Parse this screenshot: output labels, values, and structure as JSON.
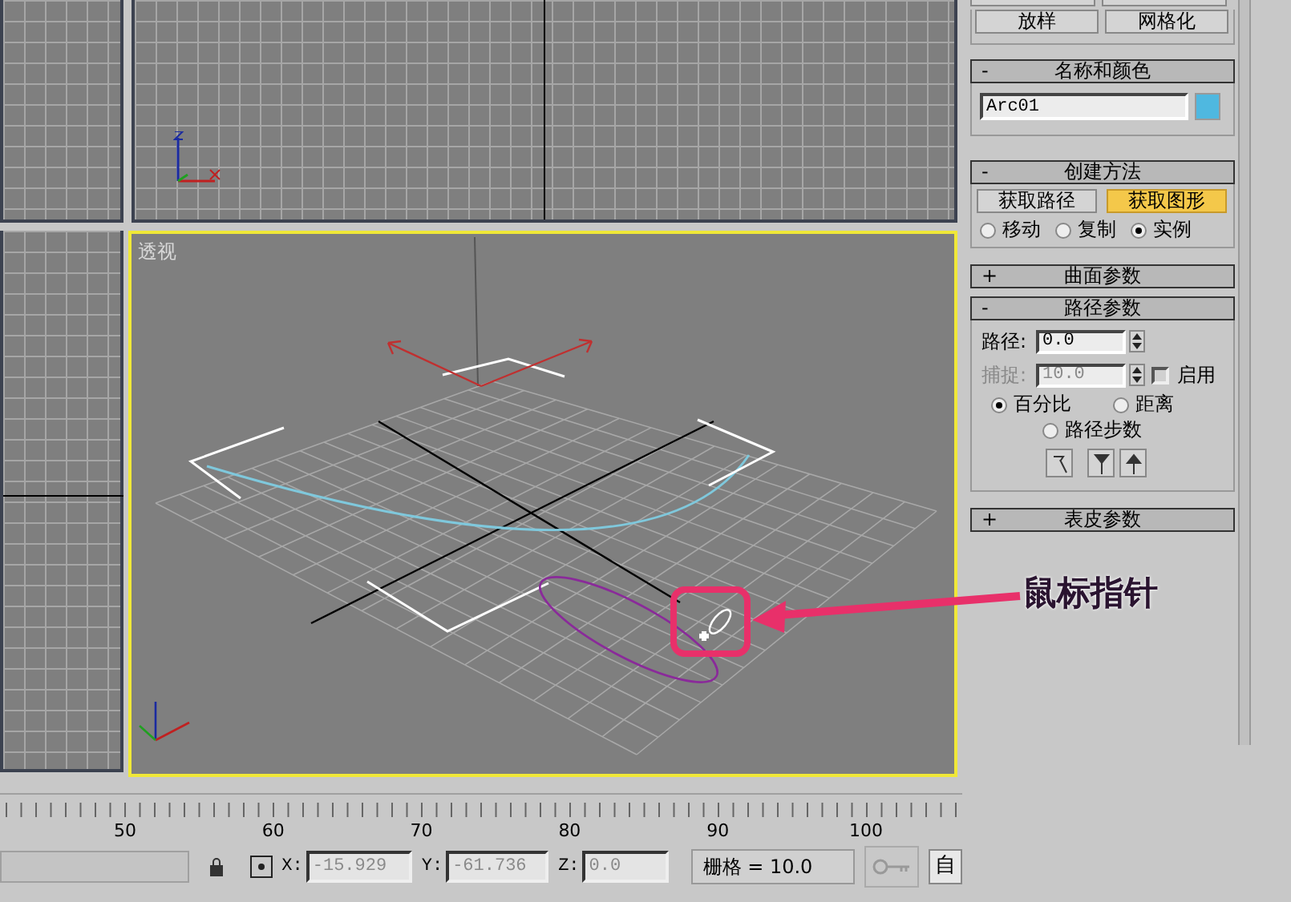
{
  "viewports": [
    {
      "label": "透视",
      "active": true
    }
  ],
  "panel": {
    "top_buttons": [
      "放样",
      "网格化"
    ],
    "rollouts": [
      {
        "kind": "name",
        "sign": "-",
        "title": "名称和颜色",
        "name": "Arc01",
        "color": "#4fb8e0"
      },
      {
        "kind": "create",
        "sign": "-",
        "title": "创建方法",
        "buttons": [
          {
            "label": "获取路径",
            "selected": false
          },
          {
            "label": "获取图形",
            "selected": true
          }
        ],
        "radios": [
          {
            "label": "移动",
            "selected": false
          },
          {
            "label": "复制",
            "selected": false
          },
          {
            "label": "实例",
            "selected": true
          }
        ]
      },
      {
        "kind": "collapsed",
        "sign": "+",
        "title": "曲面参数"
      },
      {
        "kind": "path",
        "sign": "-",
        "title": "路径参数",
        "path_label": "路径:",
        "path_value": "0.0",
        "snap_label": "捕捉:",
        "snap_value": "10.0",
        "snap_disabled": true,
        "enable_label": "启用",
        "enable_checked": false,
        "radios": [
          {
            "label": "百分比",
            "selected": true
          },
          {
            "label": "距离",
            "selected": false
          },
          {
            "label": "路径步数",
            "selected": false
          }
        ]
      },
      {
        "kind": "collapsed",
        "sign": "+",
        "title": "表皮参数"
      }
    ]
  },
  "timeline": {
    "ticks": [
      "50",
      "60",
      "70",
      "80",
      "90",
      "100"
    ]
  },
  "status_bar": {
    "x_label": "X:",
    "x_value": "-15.929",
    "y_label": "Y:",
    "y_value": "-61.736",
    "z_label": "Z:",
    "z_value": "0.0",
    "grid": "栅格 = 10.0",
    "auto": "自"
  },
  "annotation": {
    "text": "鼠标指针"
  }
}
